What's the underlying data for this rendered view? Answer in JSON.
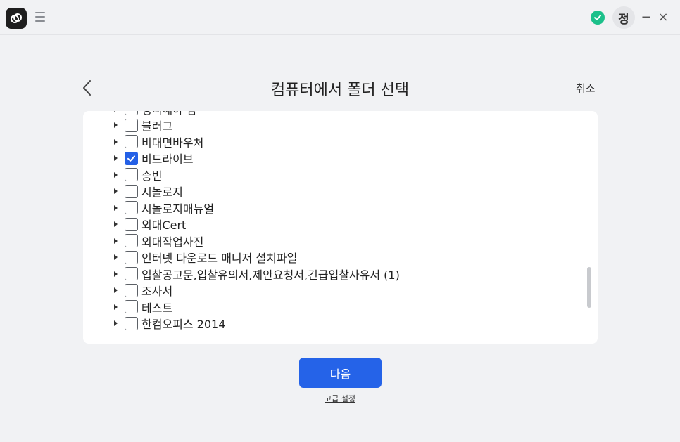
{
  "titlebar": {
    "avatar_initial": "정",
    "minimize_label": "−",
    "close_label": "×",
    "sync_status": "synced"
  },
  "header": {
    "title": "컴퓨터에서 폴더 선택",
    "cancel_label": "취소"
  },
  "tree": {
    "items": [
      {
        "label": "정리해야 함",
        "checked": false
      },
      {
        "label": "블러그",
        "checked": false
      },
      {
        "label": "비대면바우처",
        "checked": false
      },
      {
        "label": "비드라이브",
        "checked": true
      },
      {
        "label": "승빈",
        "checked": false
      },
      {
        "label": "시놀로지",
        "checked": false
      },
      {
        "label": "시놀로지매뉴얼",
        "checked": false
      },
      {
        "label": "외대Cert",
        "checked": false
      },
      {
        "label": "외대작업사진",
        "checked": false
      },
      {
        "label": "인터넷 다운로드 매니저 설치파일",
        "checked": false
      },
      {
        "label": "입찰공고문,입찰유의서,제안요청서,긴급입찰사유서 (1)",
        "checked": false
      },
      {
        "label": "조사서",
        "checked": false
      },
      {
        "label": "테스트",
        "checked": false
      },
      {
        "label": "한컴오피스 2014",
        "checked": false
      }
    ]
  },
  "footer": {
    "next_label": "다음",
    "advanced_label": "고급 설정"
  },
  "colors": {
    "accent": "#2563e8",
    "sync_green": "#1cc08a",
    "background": "#f1f2f4"
  }
}
